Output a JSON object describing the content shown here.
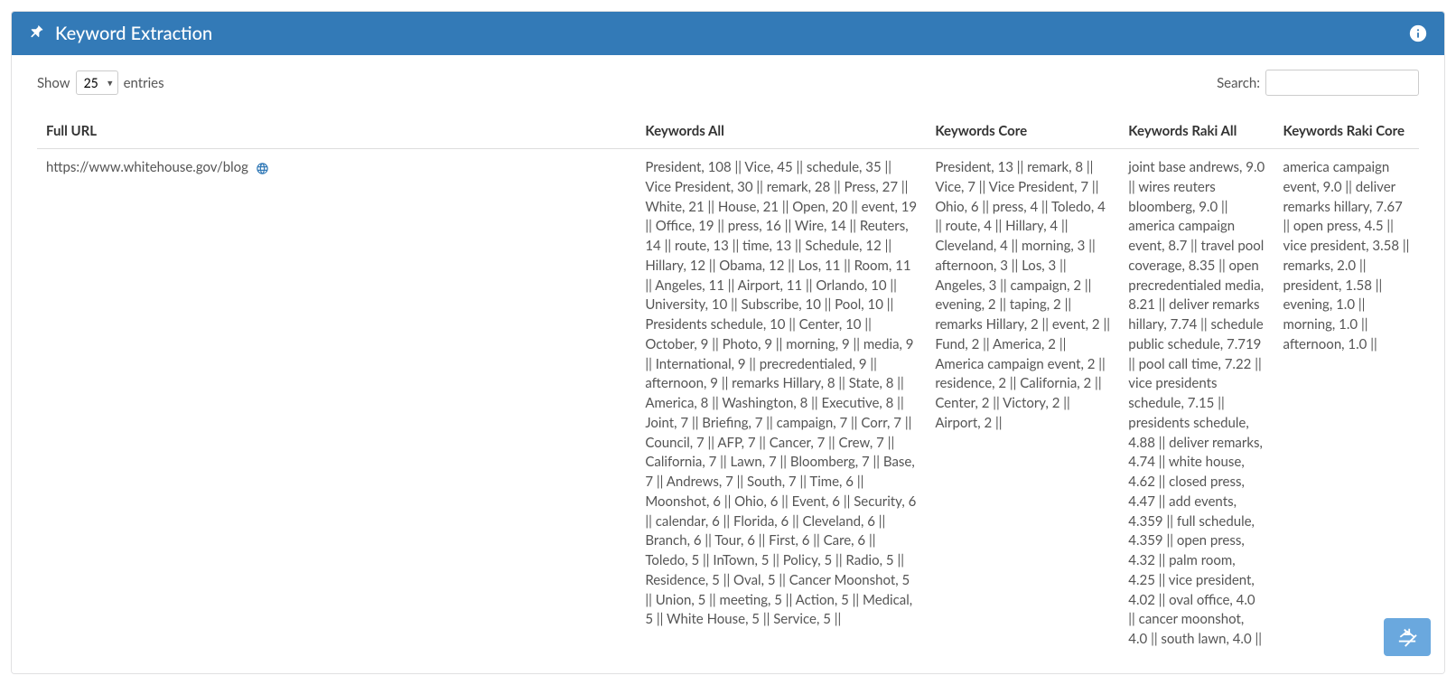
{
  "panel": {
    "title": "Keyword Extraction"
  },
  "controls": {
    "show_prefix": "Show",
    "show_suffix": "entries",
    "page_size": "25",
    "search_label": "Search:"
  },
  "table": {
    "headers": {
      "full_url": "Full URL",
      "keywords_all": "Keywords All",
      "keywords_core": "Keywords Core",
      "keywords_raki_all": "Keywords Raki All",
      "keywords_raki_core": "Keywords Raki Core"
    },
    "rows": [
      {
        "url": "https://www.whitehouse.gov/blog",
        "keywords_all": "President, 108 || Vice, 45 || schedule, 35 || Vice President, 30 || remark, 28 || Press, 27 || White, 21 || House, 21 || Open, 20 || event, 19 || Office, 19 || press, 16 || Wire, 14 || Reuters, 14 || route, 13 || time, 13 || Schedule, 12 || Hillary, 12 || Obama, 12 || Los, 11 || Room, 11 || Angeles, 11 || Airport, 11 || Orlando, 10 || University, 10 || Subscribe, 10 || Pool, 10 || Presidents schedule, 10 || Center, 10 || October, 9 || Photo, 9 || morning, 9 || media, 9 || International, 9 || precredentialed, 9 || afternoon, 9 || remarks Hillary, 8 || State, 8 || America, 8 || Washington, 8 || Executive, 8 || Joint, 7 || Briefing, 7 || campaign, 7 || Corr, 7 || Council, 7 || AFP, 7 || Cancer, 7 || Crew, 7 || California, 7 || Lawn, 7 || Bloomberg, 7 || Base, 7 || Andrews, 7 || South, 7 || Time, 6 || Moonshot, 6 || Ohio, 6 || Event, 6 || Security, 6 || calendar, 6 || Florida, 6 || Cleveland, 6 || Branch, 6 || Tour, 6 || First, 6 || Care, 6 || Toledo, 5 || InTown, 5 || Policy, 5 || Radio, 5 || Residence, 5 || Oval, 5 || Cancer Moonshot, 5 || Union, 5 || meeting, 5 || Action, 5 || Medical, 5 || White House, 5 || Service, 5 ||",
        "keywords_core": "President, 13 || remark, 8 || Vice, 7 || Vice President, 7 || Ohio, 6 || press, 4 || Toledo, 4 || route, 4 || Hillary, 4 || Cleveland, 4 || morning, 3 || afternoon, 3 || Los, 3 || Angeles, 3 || campaign, 2 || evening, 2 || taping, 2 || remarks Hillary, 2 || event, 2 || Fund, 2 || America, 2 || America campaign event, 2 || residence, 2 || California, 2 || Center, 2 || Victory, 2 || Airport, 2 ||",
        "keywords_raki_all": "joint base andrews, 9.0 || wires reuters bloomberg, 9.0 || america campaign event, 8.7 || travel pool coverage, 8.35 || open precredentialed media, 8.21 || deliver remarks hillary, 7.74 || schedule public schedule, 7.719 || pool call time, 7.22 || vice presidents schedule, 7.15 || presidents schedule, 4.88 || deliver remarks, 4.74 || white house, 4.62 || closed press, 4.47 || add events, 4.359 || full schedule, 4.359 || open press, 4.32 || palm room, 4.25 || vice president, 4.02 || oval office, 4.0 || cancer moonshot, 4.0 || south lawn, 4.0 ||",
        "keywords_raki_core": "america campaign event, 9.0 || deliver remarks hillary, 7.67 || open press, 4.5 || vice president, 3.58 || remarks, 2.0 || president, 1.58 || evening, 1.0 || morning, 1.0 || afternoon, 1.0 ||"
      }
    ]
  }
}
